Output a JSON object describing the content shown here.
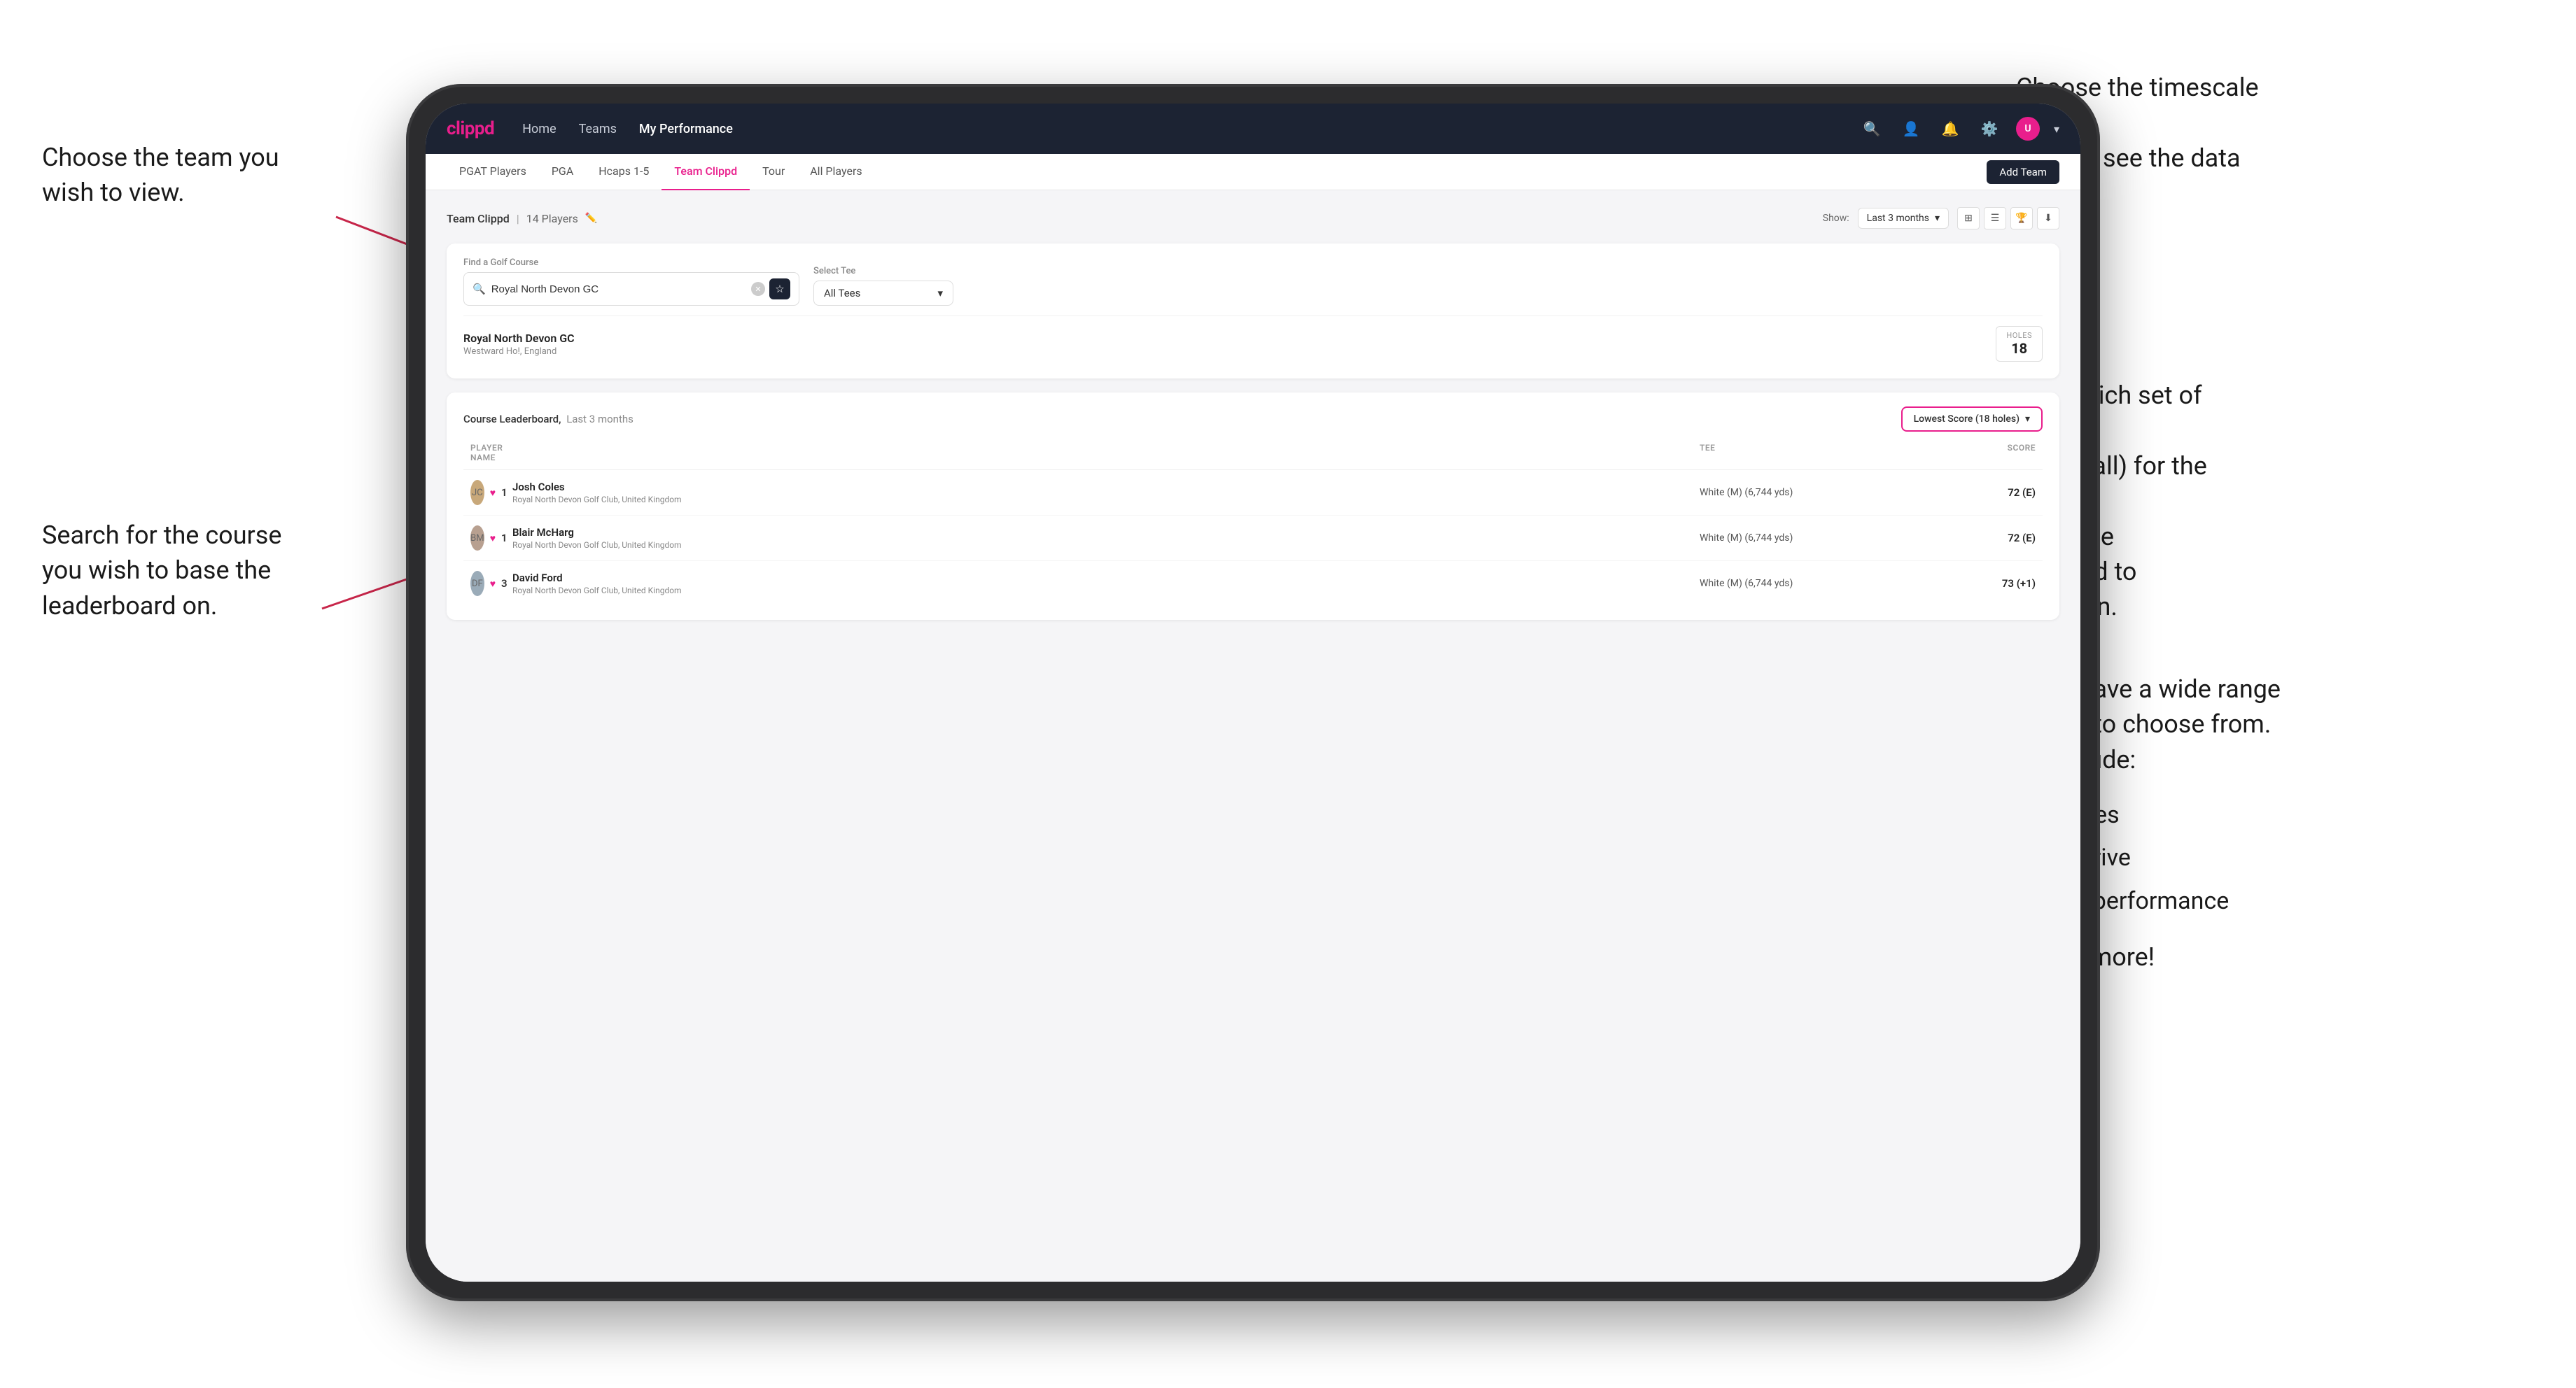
{
  "annotations": {
    "top_left_title": "Choose the team you\nwish to view.",
    "middle_left_title": "Search for the course\nyou wish to base the\nleaderboard on.",
    "top_right_title": "Choose the timescale you\nwish to see the data over.",
    "middle_right_title": "Choose which set of tees\n(default is all) for the course\nyou wish the leaderboard to\nbe based on.",
    "bottom_right_title": "Here you have a wide range\nof options to choose from.\nThese include:",
    "bullet1": "Most birdies",
    "bullet2": "Longest drive",
    "bullet3": "Best APP performance",
    "and_more": "and many more!"
  },
  "nav": {
    "logo": "clippd",
    "links": [
      "Home",
      "Teams",
      "My Performance"
    ],
    "active_link": "My Performance"
  },
  "sub_nav": {
    "tabs": [
      "PGAT Players",
      "PGA",
      "Hcaps 1-5",
      "Team Clippd",
      "Tour",
      "All Players"
    ],
    "active_tab": "Team Clippd",
    "add_team_label": "Add Team"
  },
  "team_header": {
    "title": "Team Clippd",
    "player_count": "14 Players",
    "show_label": "Show:",
    "show_value": "Last 3 months"
  },
  "course_finder": {
    "find_label": "Find a Golf Course",
    "search_value": "Royal North Devon GC",
    "select_tee_label": "Select Tee",
    "tee_value": "All Tees",
    "course_name": "Royal North Devon GC",
    "course_location": "Westward Ho!, England",
    "holes_label": "Holes",
    "holes_value": "18"
  },
  "leaderboard": {
    "title": "Course Leaderboard,",
    "subtitle": "Last 3 months",
    "score_type": "Lowest Score (18 holes)",
    "columns": {
      "player": "PLAYER NAME",
      "tee": "TEE",
      "score": "SCORE"
    },
    "rows": [
      {
        "rank": "1",
        "name": "Josh Coles",
        "club": "Royal North Devon Golf Club, United Kingdom",
        "tee": "White (M) (6,744 yds)",
        "score": "72 (E)"
      },
      {
        "rank": "1",
        "name": "Blair McHarg",
        "club": "Royal North Devon Golf Club, United Kingdom",
        "tee": "White (M) (6,744 yds)",
        "score": "72 (E)"
      },
      {
        "rank": "3",
        "name": "David Ford",
        "club": "Royal North Devon Golf Club, United Kingdom",
        "tee": "White (M) (6,744 yds)",
        "score": "73 (+1)"
      }
    ]
  },
  "colors": {
    "brand_pink": "#e91e8c",
    "nav_dark": "#1c2333",
    "white": "#ffffff"
  }
}
